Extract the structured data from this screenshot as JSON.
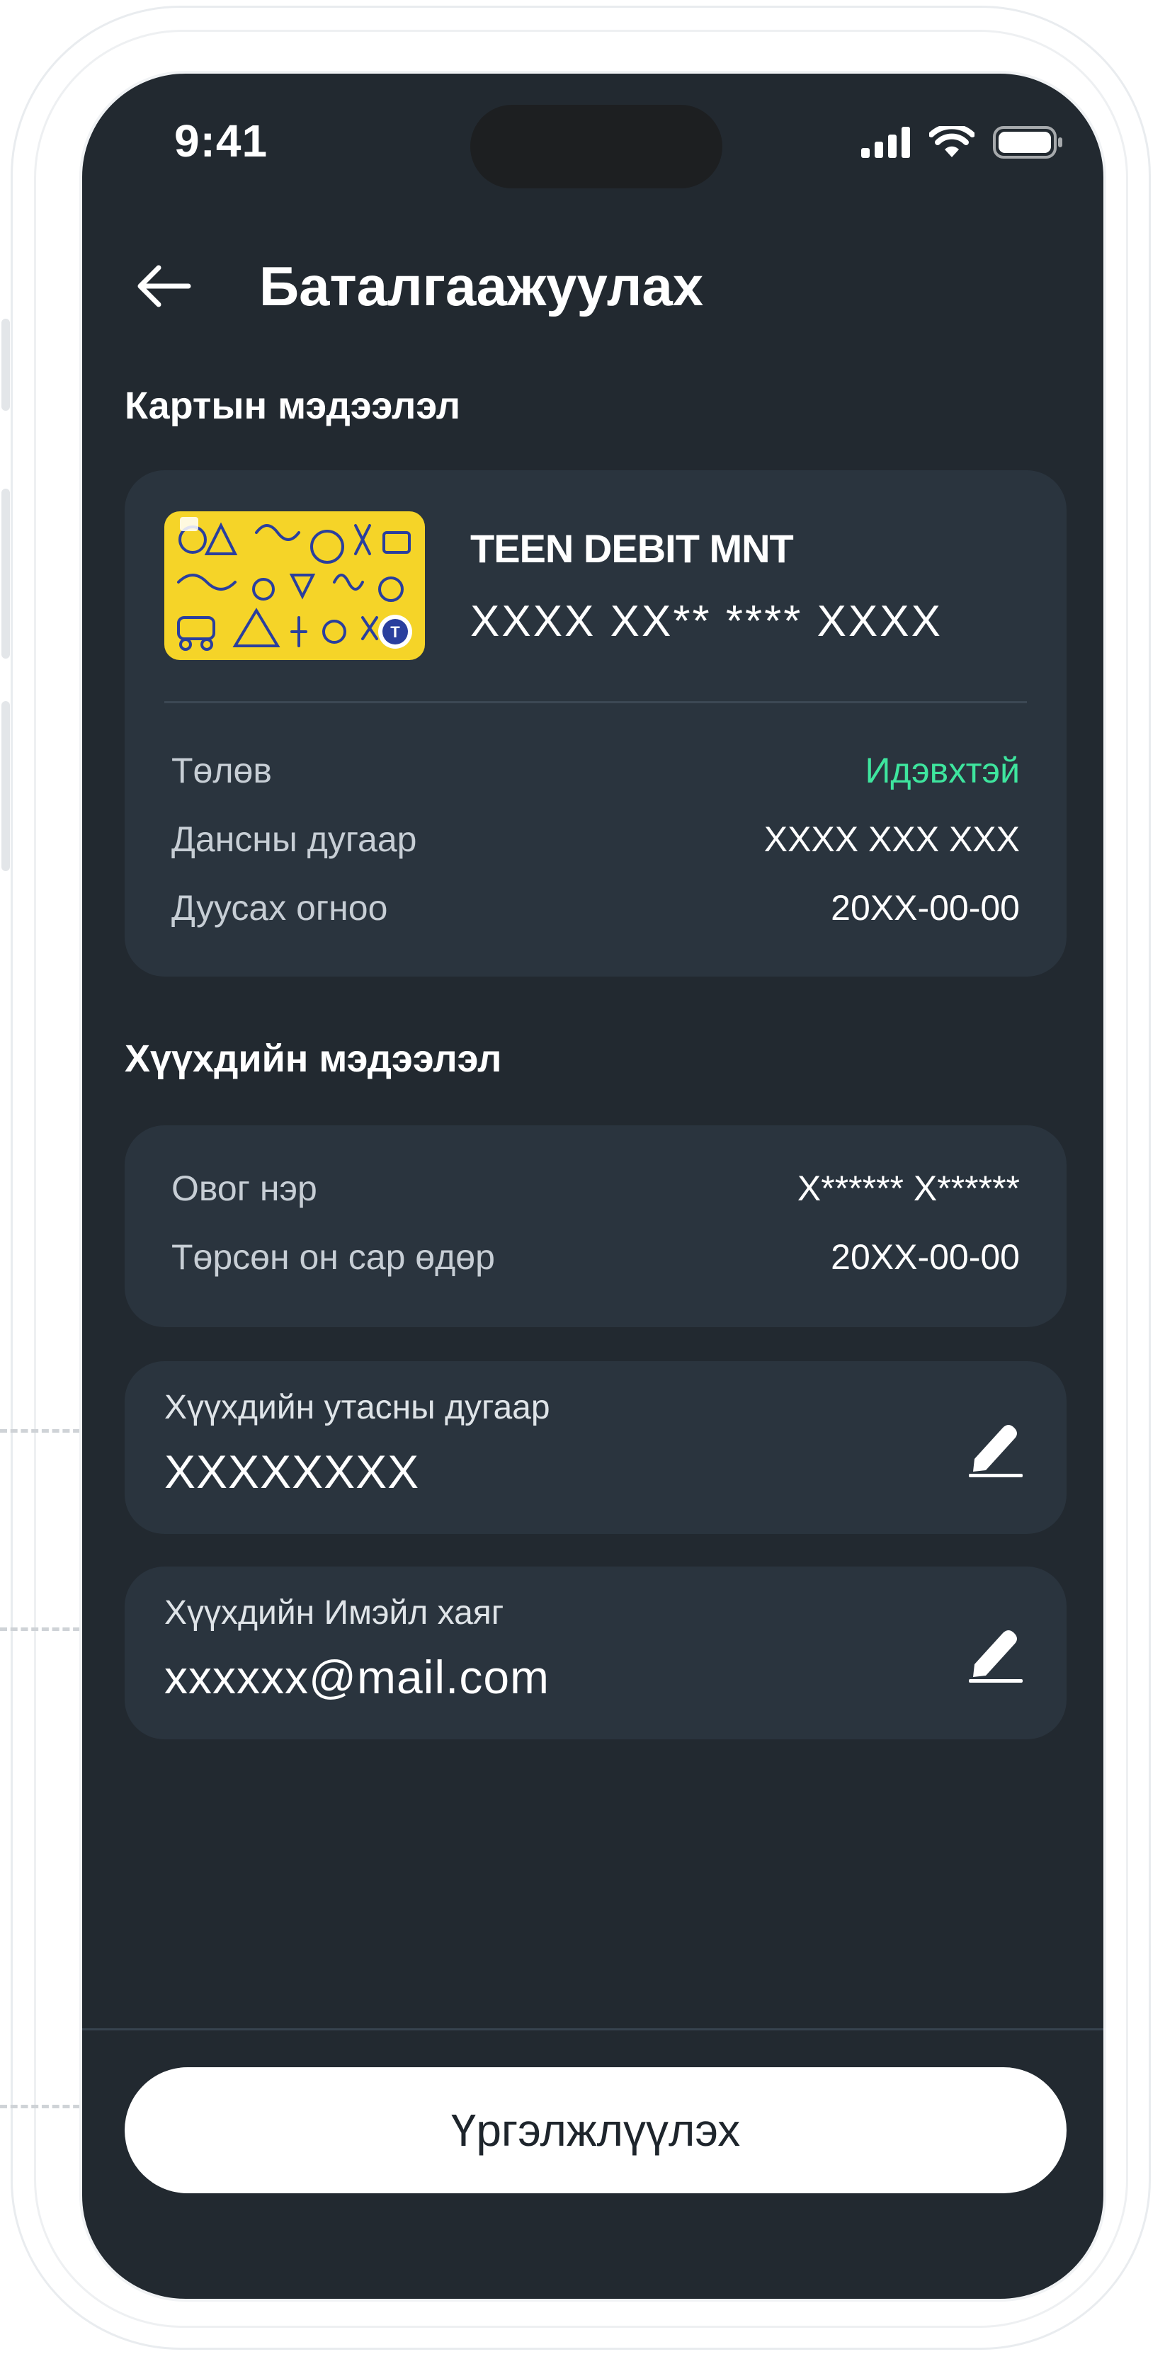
{
  "status_bar": {
    "time": "9:41"
  },
  "header": {
    "title": "Баталгаажуулах"
  },
  "card_section": {
    "label": "Картын мэдээлэл",
    "card_name": "TEEN DEBIT MNT",
    "card_number": "XXXX XX** **** XXXX",
    "rows": [
      {
        "key": "Төлөв",
        "value": "Идэвхтэй"
      },
      {
        "key": "Дансны дугаар",
        "value": "XXXX XXX XXX"
      },
      {
        "key": "Дуусах огноо",
        "value": "20XX-00-00"
      }
    ]
  },
  "child_section": {
    "label": "Хүүхдийн мэдээлэл",
    "rows": [
      {
        "key": "Овог нэр",
        "value": "X****** X******"
      },
      {
        "key": "Төрсөн он сар өдөр",
        "value": "20XX-00-00"
      }
    ],
    "phone": {
      "label": "Хүүхдийн утасны дугаар",
      "value": "XXXXXXXX"
    },
    "email": {
      "label": "Хүүхдийн Имэйл хаяг",
      "value": "xxxxxx@mail.com"
    }
  },
  "continue_button": {
    "label": "Үргэлжлүүлэх"
  },
  "colors": {
    "background": "#222930",
    "card": "#2a343e",
    "status_active": "#3ee59e",
    "card_yellow": "#f5d428",
    "card_doodle": "#2a3f9e"
  },
  "icons": [
    "back-arrow-icon",
    "signal-icon",
    "wifi-icon",
    "battery-icon",
    "edit-pen-icon",
    "edit-pen-icon"
  ]
}
